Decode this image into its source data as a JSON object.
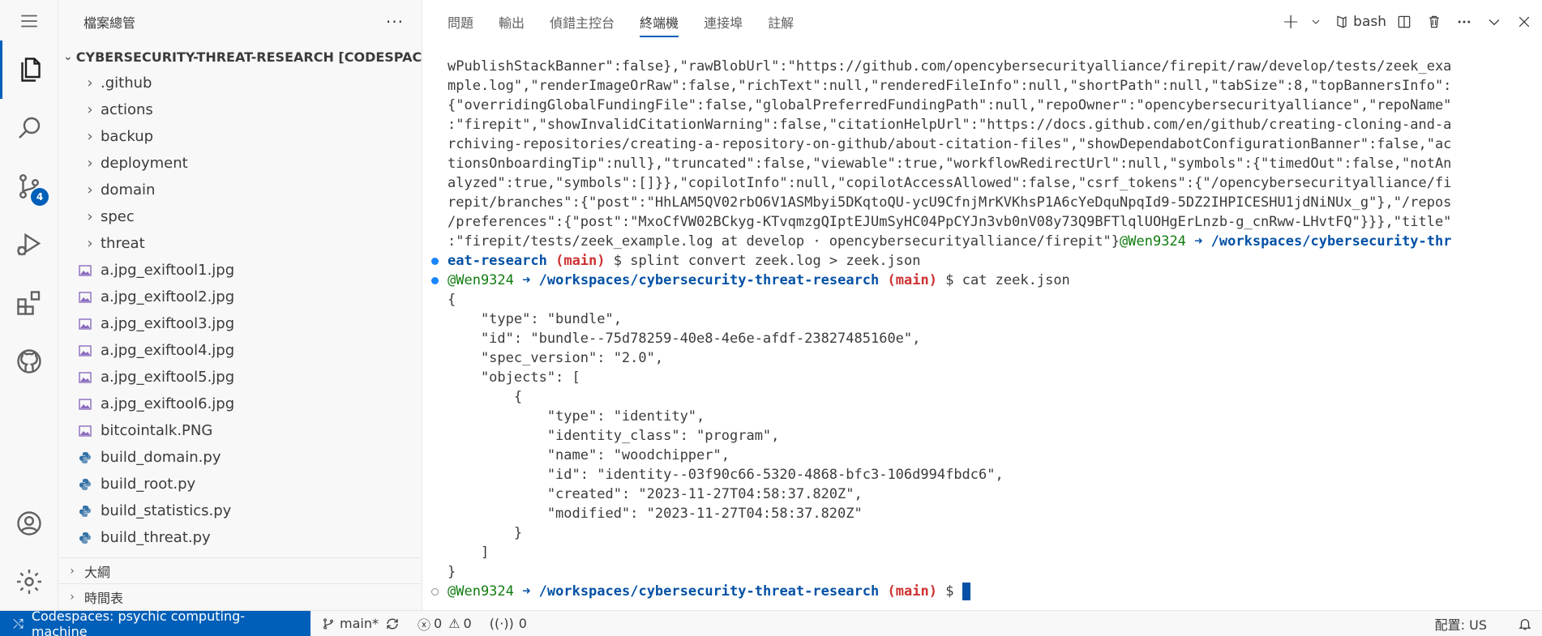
{
  "explorer": {
    "title": "檔案總管",
    "more": "···",
    "root": "CYBERSECURITY-THREAT-RESEARCH [CODESPACES:...",
    "folders": [
      ".github",
      "actions",
      "backup",
      "deployment",
      "domain",
      "spec",
      "threat"
    ],
    "files": [
      {
        "name": "a.jpg_exiftool1.jpg",
        "icon": "image-icon"
      },
      {
        "name": "a.jpg_exiftool2.jpg",
        "icon": "image-icon"
      },
      {
        "name": "a.jpg_exiftool3.jpg",
        "icon": "image-icon"
      },
      {
        "name": "a.jpg_exiftool4.jpg",
        "icon": "image-icon"
      },
      {
        "name": "a.jpg_exiftool5.jpg",
        "icon": "image-icon"
      },
      {
        "name": "a.jpg_exiftool6.jpg",
        "icon": "image-icon"
      },
      {
        "name": "bitcointalk.PNG",
        "icon": "image-icon"
      },
      {
        "name": "build_domain.py",
        "icon": "python-icon"
      },
      {
        "name": "build_root.py",
        "icon": "python-icon"
      },
      {
        "name": "build_statistics.py",
        "icon": "python-icon"
      },
      {
        "name": "build_threat.py",
        "icon": "python-icon"
      }
    ],
    "sections": [
      "大綱",
      "時間表"
    ]
  },
  "activity": {
    "scm_badge": "4"
  },
  "panel": {
    "tabs": [
      "問題",
      "輸出",
      "偵錯主控台",
      "終端機",
      "連接埠",
      "註解"
    ],
    "active_tab": 3,
    "shell": "bash",
    "add": "+"
  },
  "terminal": {
    "output_lines": [
      "wPublishStackBanner\":false},\"rawBlobUrl\":\"https://github.com/opencybersecurityalliance/firepit/raw/develop/tests/zeek_exa",
      "mple.log\",\"renderImageOrRaw\":false,\"richText\":null,\"renderedFileInfo\":null,\"shortPath\":null,\"tabSize\":8,\"topBannersInfo\":",
      "{\"overridingGlobalFundingFile\":false,\"globalPreferredFundingPath\":null,\"repoOwner\":\"opencybersecurityalliance\",\"repoName\"",
      ":\"firepit\",\"showInvalidCitationWarning\":false,\"citationHelpUrl\":\"https://docs.github.com/en/github/creating-cloning-and-a",
      "rchiving-repositories/creating-a-repository-on-github/about-citation-files\",\"showDependabotConfigurationBanner\":false,\"ac",
      "tionsOnboardingTip\":null},\"truncated\":false,\"viewable\":true,\"workflowRedirectUrl\":null,\"symbols\":{\"timedOut\":false,\"notAn",
      "alyzed\":true,\"symbols\":[]}},\"copilotInfo\":null,\"copilotAccessAllowed\":false,\"csrf_tokens\":{\"/opencybersecurityalliance/fi",
      "repit/branches\":{\"post\":\"HhLAM5QV02rbO6V1ASMbyi5DKqtoQU-ycU9CfnjMrKVKhsP1A6cYeDquNpqId9-5DZ2IHPICESHU1jdNiNUx_g\"},\"/repos",
      "/preferences\":{\"post\":\"MxoCfVW02BCkyg-KTvqmzgQIptEJUmSyHC04PpCYJn3vb0nV08y73Q9BFTlqlUOHgErLnzb-g_cnRww-LHvtFQ\"}}},\"title\"",
      ":\"firepit/tests/zeek_example.log at develop · opencybersecurityalliance/firepit\"}"
    ],
    "user": "@Wen9324",
    "arrow": "➜",
    "path_part1": "/workspaces/cybersecurity-thr",
    "path_part2": "eat-research",
    "path": "/workspaces/cybersecurity-threat-research",
    "branch_open": "(",
    "branch": "main",
    "branch_close": ")",
    "dollar": "$",
    "cmd1": "splint convert zeek.log > zeek.json",
    "cmd2": "cat zeek.json",
    "json_lines": [
      "{",
      "    \"type\": \"bundle\",",
      "    \"id\": \"bundle--75d78259-40e8-4e6e-afdf-23827485160e\",",
      "    \"spec_version\": \"2.0\",",
      "    \"objects\": [",
      "        {",
      "            \"type\": \"identity\",",
      "            \"identity_class\": \"program\",",
      "            \"name\": \"woodchipper\",",
      "            \"id\": \"identity--03f90c66-5320-4868-bfc3-106d994fbdc6\",",
      "            \"created\": \"2023-11-27T04:58:37.820Z\",",
      "            \"modified\": \"2023-11-27T04:58:37.820Z\"",
      "        }",
      "    ]",
      "}"
    ]
  },
  "status": {
    "remote": "Codespaces: psychic computing-machine",
    "branch": "main*",
    "errors": "0",
    "warnings": "0",
    "ports": "0",
    "layout": "配置: US"
  }
}
